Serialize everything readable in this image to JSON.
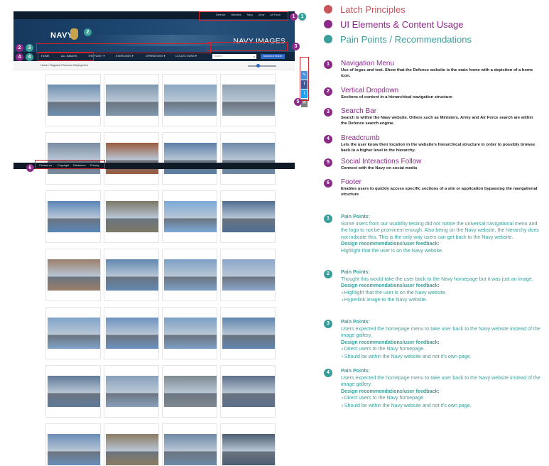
{
  "mockup": {
    "top_links": [
      "Defence",
      "Ministers",
      "Navy",
      "Army",
      "Air Force"
    ],
    "logo_text": "NAVY",
    "site_title": "NAVY IMAGES",
    "nav_items": [
      "HOME",
      "ALL IMAGES",
      "THE FLEET ▾",
      "EXERCISES ▾",
      "OPERATIONS ▾",
      "COLLECTIONS ▾"
    ],
    "search_placeholder": "Search",
    "search_icon": "search-icon",
    "advanced_search": "Advanced Search",
    "breadcrumb": "Home  /  Regional Presence Deployment",
    "zoom_level": 0.35,
    "social": [
      {
        "icon": "link-icon",
        "glyph": "✎",
        "color": "#4a90d9"
      },
      {
        "icon": "facebook-icon",
        "glyph": "f",
        "color": "#3b5998"
      },
      {
        "icon": "twitter-icon",
        "glyph": "t",
        "color": "#1da1f2"
      },
      {
        "icon": "email-icon",
        "glyph": "✉",
        "color": "#7d7d7d"
      }
    ],
    "footer_links": [
      "Contact us",
      "Copyright",
      "Disclaimer",
      "Privacy"
    ],
    "photos": [
      "#6d8fb0",
      "#7f98ad",
      "#8aa6c2",
      "#8fa2b2",
      "#7a8da0",
      "#9a5b3e",
      "#5b7fa6",
      "#6f8aa8",
      "#5a86b8",
      "#7c7866",
      "#7ba9d8",
      "#4f6e93",
      "#9a7f6a",
      "#6287b0",
      "#7da0c4",
      "#8ba7c9",
      "#7fa3c8",
      "#6d92bf",
      "#7b9fc4",
      "#5f84ad",
      "#607a99",
      "#88a0bb",
      "#7f8a92",
      "#5d6f8a",
      "#6a8eb8",
      "#8c7c62",
      "#6f8aa6",
      "#4c5d72"
    ]
  },
  "legend": [
    {
      "label": "Latch Principles",
      "color": "#c8545c"
    },
    {
      "label": "UI Elements & Content Usage",
      "color": "#8c2a8a"
    },
    {
      "label": "Pain Points / Recommendations",
      "color": "#3a9f9b"
    }
  ],
  "elements": [
    {
      "n": "1",
      "title": "Navigation Menu",
      "desc": "Use of logos and text. Show that the Defence website is the main home with a depiction of a home icon."
    },
    {
      "n": "2",
      "title": "Vertical Dropdown",
      "desc": "Sections of content in a hierarchical navigation structure"
    },
    {
      "n": "3",
      "title": "Search Bar",
      "desc": "Search is within the Navy website. Others such as Ministers, Army and Air Force search are within the Defence search engine."
    },
    {
      "n": "4",
      "title": "Breadcrumb",
      "desc": "Lets the user know their location in the website's hierarchical structure in order to possibly browse back to a higher level in the hierarchy."
    },
    {
      "n": "5",
      "title": "Social Interactions Follow",
      "desc": "Connect with the Navy on social media"
    },
    {
      "n": "6",
      "title": "Footer",
      "desc": "Enables users to quickly access specific sections of a site or application bypassing the navigational structure"
    }
  ],
  "pain_points": [
    {
      "n": "1",
      "pp_label": "Pain Points:",
      "pp_text": "Some users from our usability testing did not notice the universal navigational menu and the logo to not be prominent enough. Also being on the Navy website, the hierarchy does not indicate this. This is the only way users can get back to the Navy website.",
      "rec_label": "Design recommendations/user feedback:",
      "rec_text": "Highlight that the user is on the Navy website.",
      "bullets": []
    },
    {
      "n": "2",
      "pp_label": "Pain Points:",
      "pp_text": "Thought this would take the user back to the Navy homepage but it was just an image.",
      "rec_label": "Design recommendations/user feedback:",
      "rec_text": "",
      "bullets": [
        "Highlight that the user is on the Navy website.",
        "Hyperlink image to the Navy website."
      ]
    },
    {
      "n": "3",
      "pp_label": "Pain Points:",
      "pp_text": "Users expected the homepage menu to take user back to the Navy website instead of the image gallery.",
      "rec_label": "Design recommendations/user feedback:",
      "rec_text": "",
      "bullets": [
        "Direct users to the Navy homepage.",
        "Should be within the Navy website and not it's own page."
      ]
    },
    {
      "n": "4",
      "pp_label": "Pain Points:",
      "pp_text": "Users expected the homepage menu to take user back to the Navy website instead of the image gallery.",
      "rec_label": "Design recommendations/user feedback:",
      "rec_text": "",
      "bullets": [
        "Direct users to the Navy homepage.",
        "Should be within the Navy website and not it's own page."
      ]
    }
  ]
}
